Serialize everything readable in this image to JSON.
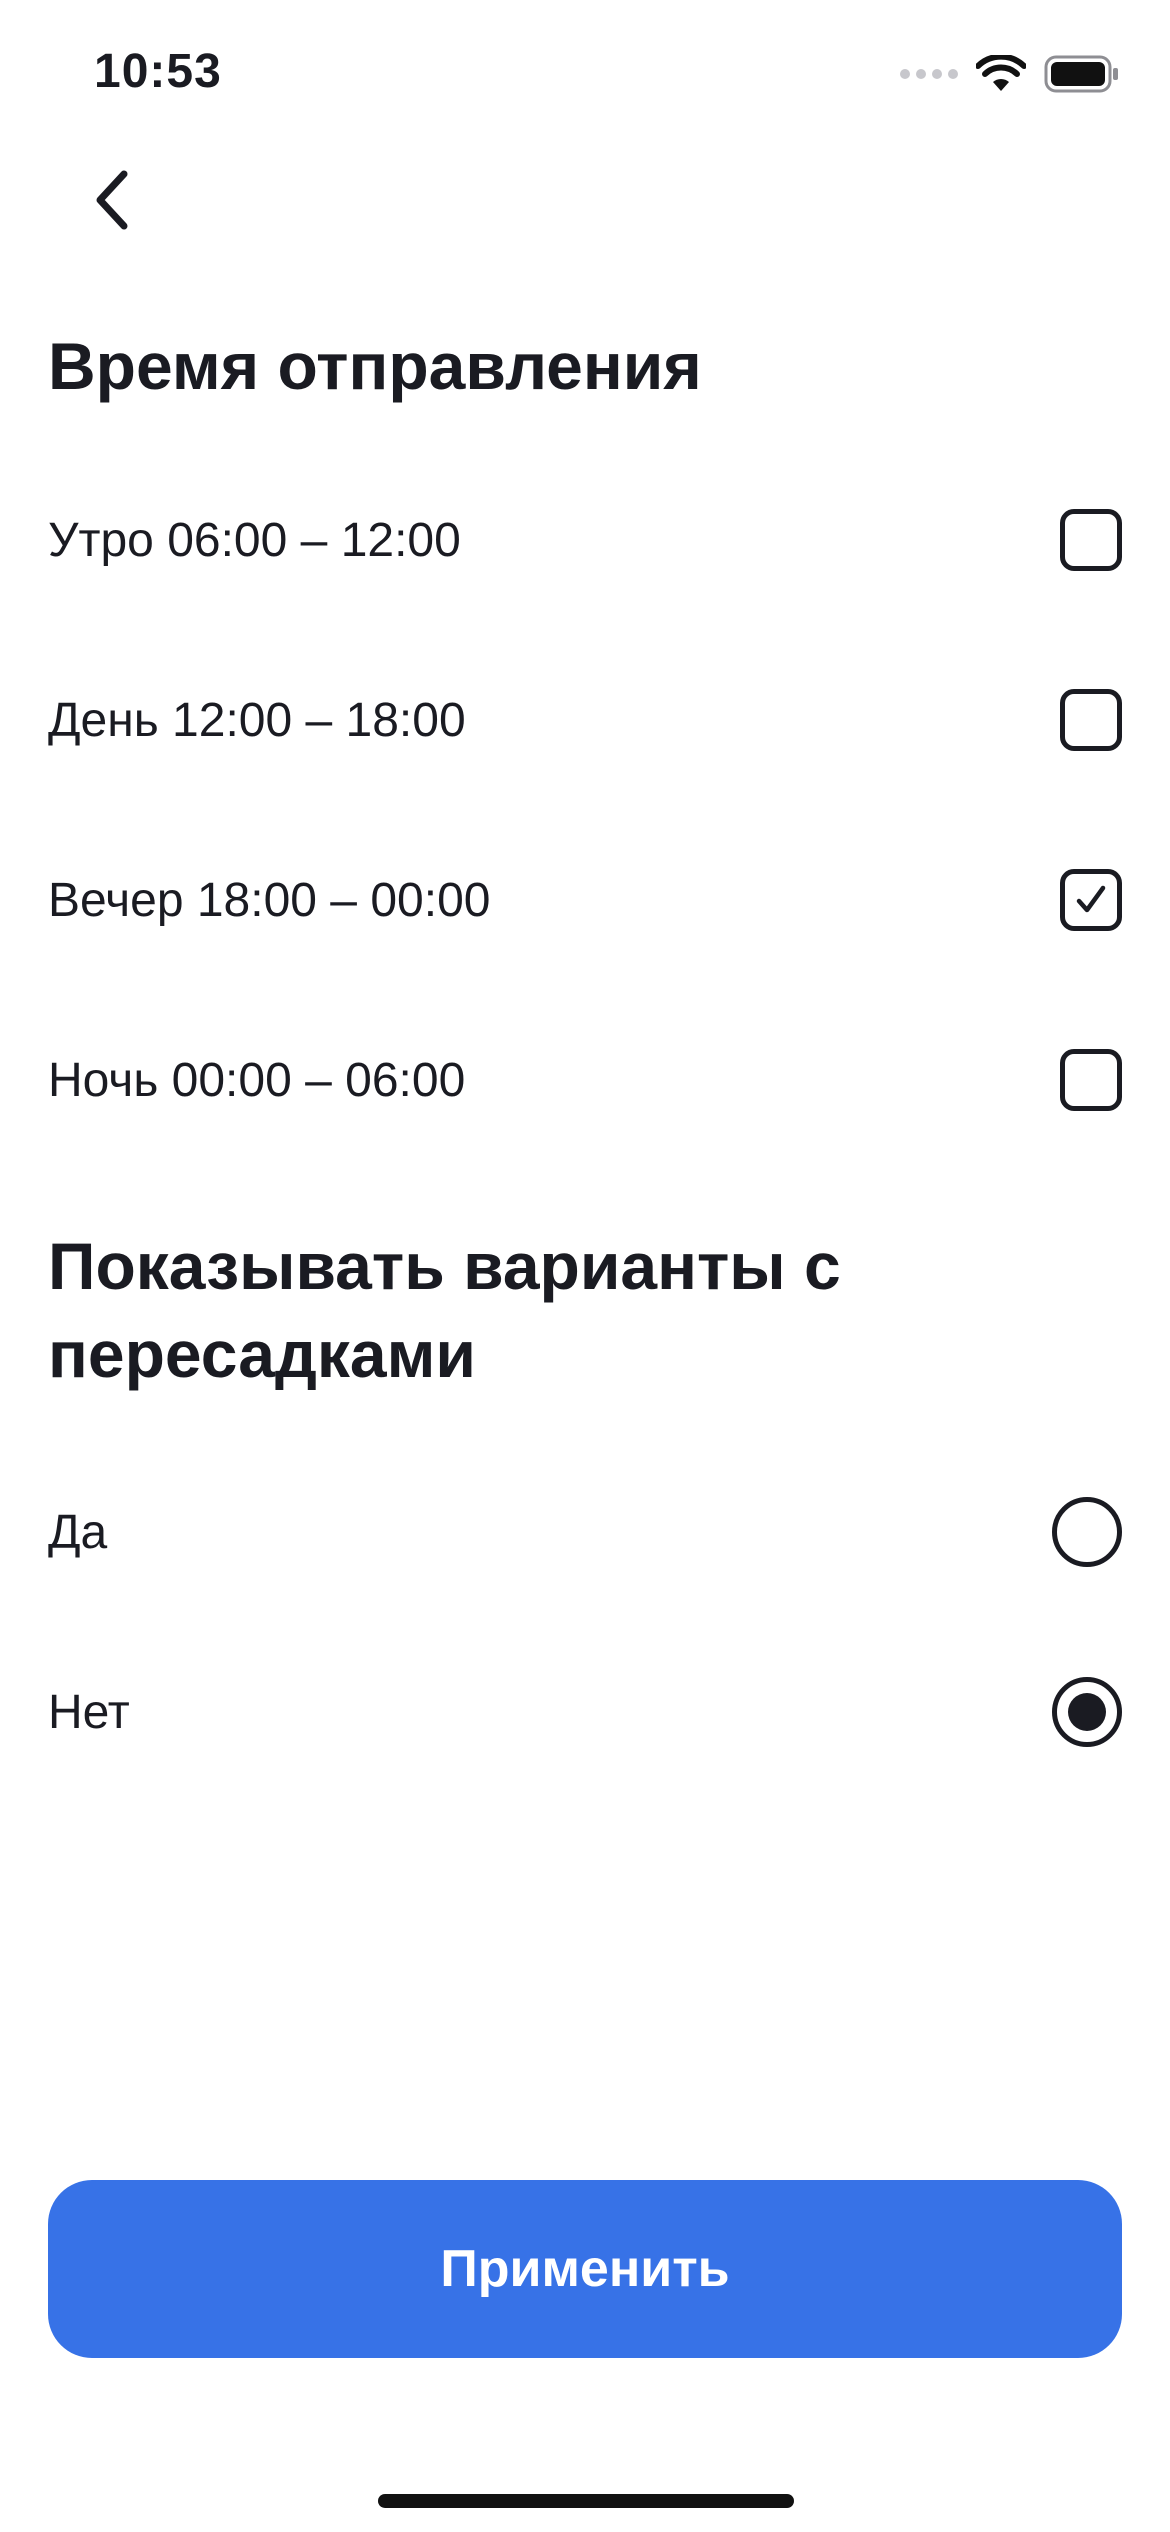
{
  "status_bar": {
    "time": "10:53",
    "icons": [
      "signal-dots-icon",
      "wifi-icon",
      "battery-icon"
    ]
  },
  "header": {
    "back_icon": "chevron-left-icon"
  },
  "departure_time": {
    "title": "Время отправления",
    "options": [
      {
        "label": "Утро 06:00 – 12:00",
        "checked": false
      },
      {
        "label": "День 12:00 – 18:00",
        "checked": false
      },
      {
        "label": "Вечер 18:00 – 00:00",
        "checked": true
      },
      {
        "label": "Ночь 00:00 – 06:00",
        "checked": false
      }
    ]
  },
  "transfers": {
    "title": "Показывать варианты с пересадками",
    "options": [
      {
        "label": "Да",
        "selected": false
      },
      {
        "label": "Нет",
        "selected": true
      }
    ]
  },
  "apply_button": {
    "label": "Применить"
  },
  "colors": {
    "accent": "#3772E7",
    "text": "#1A1B22",
    "background": "#FFFFFF"
  }
}
